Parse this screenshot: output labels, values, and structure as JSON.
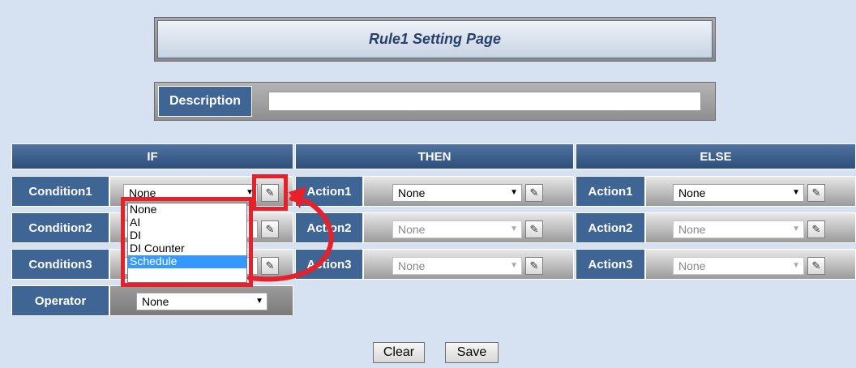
{
  "title": "Rule1 Setting Page",
  "description": {
    "label": "Description",
    "value": ""
  },
  "sections": {
    "if": "IF",
    "then": "THEN",
    "else": "ELSE"
  },
  "conditions": [
    {
      "label": "Condition1",
      "value": "None"
    },
    {
      "label": "Condition2",
      "value": ""
    },
    {
      "label": "Condition3",
      "value": ""
    }
  ],
  "then_actions": [
    {
      "label": "Action1",
      "value": "None"
    },
    {
      "label": "Action2",
      "value": "None"
    },
    {
      "label": "Action3",
      "value": "None"
    }
  ],
  "else_actions": [
    {
      "label": "Action1",
      "value": "None"
    },
    {
      "label": "Action2",
      "value": "None"
    },
    {
      "label": "Action3",
      "value": "None"
    }
  ],
  "operator": {
    "label": "Operator",
    "value": "None"
  },
  "dropdown_options": [
    "None",
    "AI",
    "DI",
    "DI Counter",
    "Schedule"
  ],
  "dropdown_selected": "Schedule",
  "buttons": {
    "clear": "Clear",
    "save": "Save"
  },
  "highlight_color": "#e8202a",
  "icons": {
    "edit": "edit-icon",
    "arrow": "chevron-down-icon"
  }
}
